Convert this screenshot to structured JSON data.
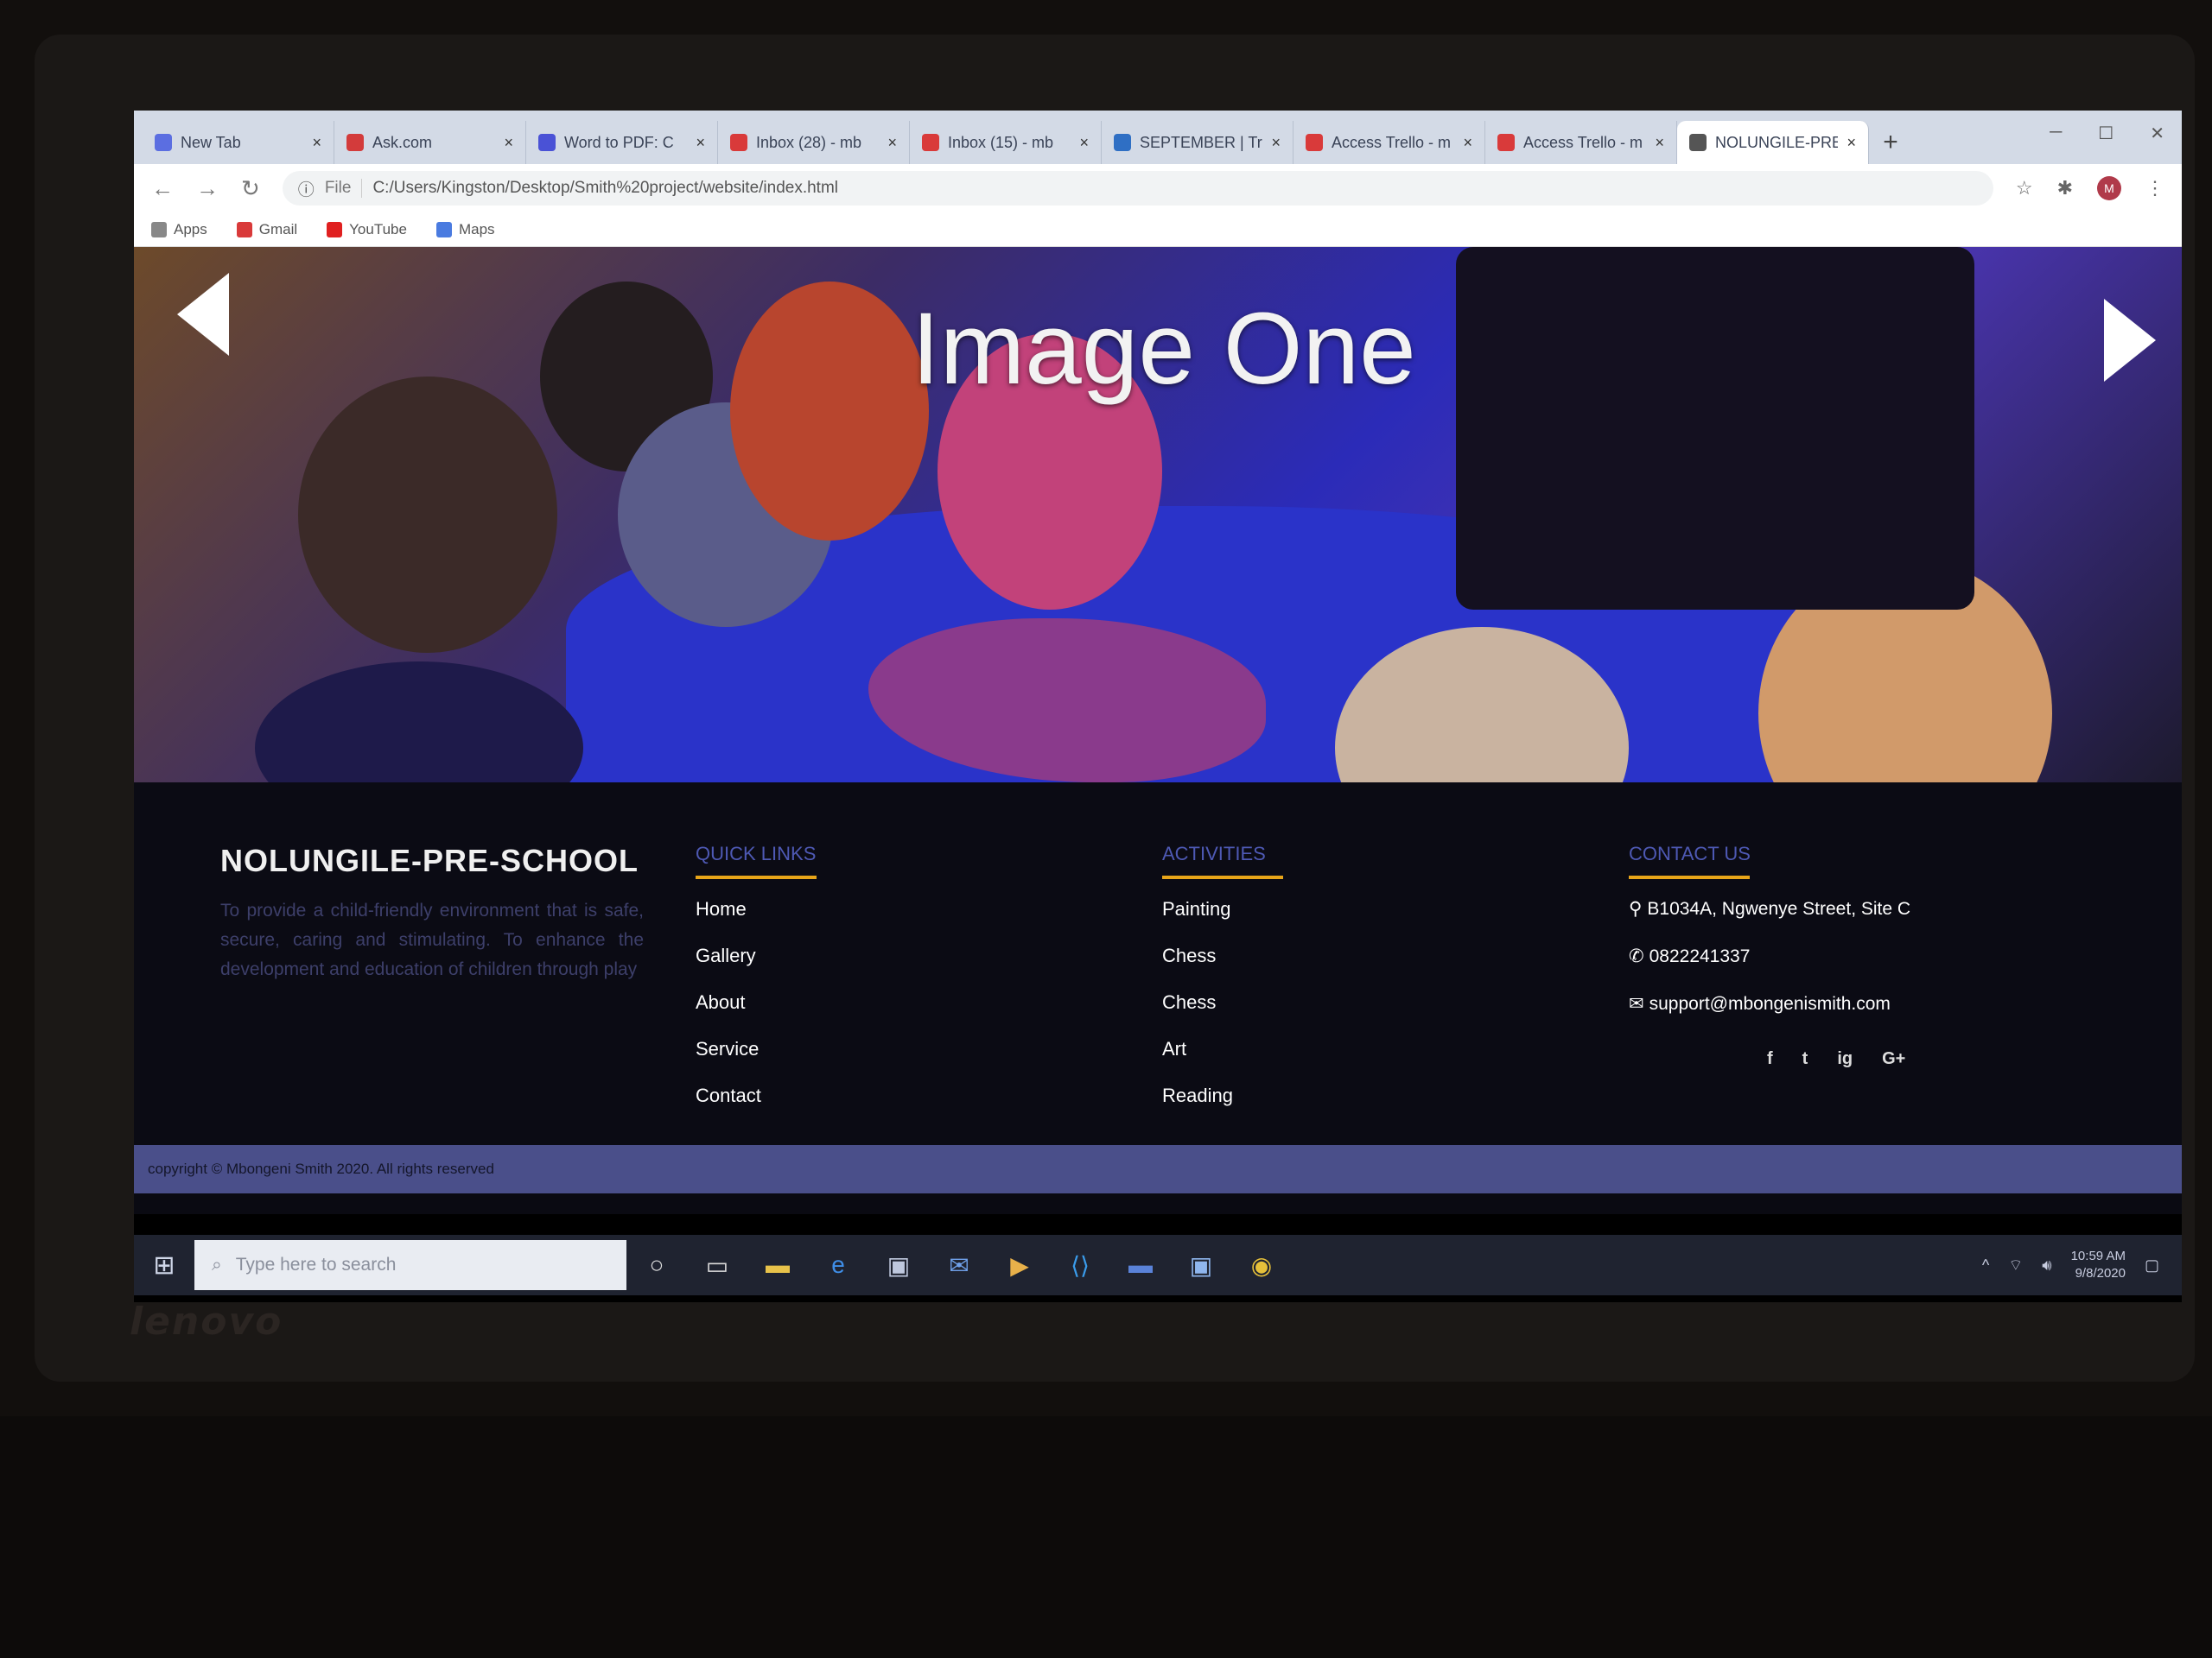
{
  "browser": {
    "tabs": [
      {
        "label": "New Tab",
        "icon": "tab-icon",
        "color": "#5b6ee1"
      },
      {
        "label": "Ask.com",
        "icon": "ask-icon",
        "color": "#d33b3b"
      },
      {
        "label": "Word to PDF: C",
        "icon": "pdf-icon",
        "color": "#4a52d6"
      },
      {
        "label": "Inbox (28) - mb",
        "icon": "gmail-icon",
        "color": "#d93a3a"
      },
      {
        "label": "Inbox (15) - mb",
        "icon": "gmail-icon",
        "color": "#d93a3a"
      },
      {
        "label": "SEPTEMBER | Tr",
        "icon": "trello-icon",
        "color": "#2f6fc4"
      },
      {
        "label": "Access Trello - m",
        "icon": "gmail-icon",
        "color": "#d93a3a"
      },
      {
        "label": "Access Trello - m",
        "icon": "gmail-icon",
        "color": "#d93a3a"
      },
      {
        "label": "NOLUNGILE-PRE",
        "icon": "globe-icon",
        "color": "#555555"
      }
    ],
    "new_tab": "+",
    "address_chip": "File",
    "url": "C:/Users/Kingston/Desktop/Smith%20project/website/index.html",
    "avatar_initial": "M",
    "bookmarks": [
      {
        "label": "Apps",
        "color": "#888888"
      },
      {
        "label": "Gmail",
        "color": "#d93a3a"
      },
      {
        "label": "YouTube",
        "color": "#e02020"
      },
      {
        "label": "Maps",
        "color": "#4a7be0"
      }
    ]
  },
  "hero": {
    "title": "Image One"
  },
  "footer": {
    "brand": "NOLUNGILE-PRE-SCHOOL",
    "mission": "To provide a child-friendly environment that is safe, secure, caring and stimulating. To enhance the development and education of children through play",
    "quick_links": {
      "heading": "QUICK LINKS",
      "items": [
        "Home",
        "Gallery",
        "About",
        "Service",
        "Contact"
      ]
    },
    "activities": {
      "heading": "ACTIVITIES",
      "items": [
        "Painting",
        "Chess",
        "Chess",
        "Art",
        "Reading"
      ]
    },
    "contact": {
      "heading": "CONTACT US",
      "address": "B1034A, Ngwenye Street, Site C",
      "phone": "0822241337",
      "email": "support@mbongenismith.com"
    },
    "socials": [
      "f",
      "t",
      "ig",
      "G+"
    ],
    "copyright": "copyright © Mbongeni Smith 2020. All rights reserved"
  },
  "taskbar": {
    "search_placeholder": "Type here to search",
    "time": "10:59 AM",
    "date": "9/8/2020"
  },
  "laptop": {
    "brand": "lenovo"
  },
  "colors": {
    "accent_underline": "#e8a519",
    "footer_heading": "#4e59b4",
    "footer_bg": "#0b0b14",
    "copyright_bar": "#4a4f8a"
  }
}
